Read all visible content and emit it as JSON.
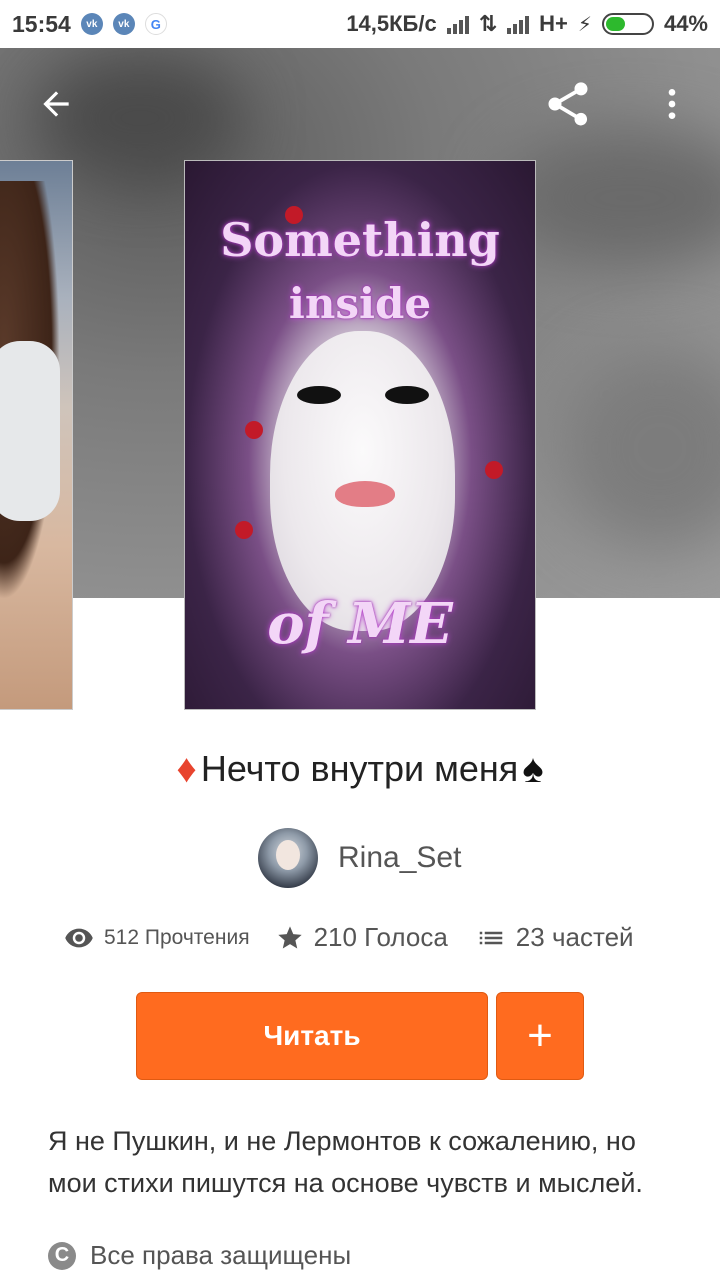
{
  "status_bar": {
    "time": "15:54",
    "apps": [
      "vk",
      "vk",
      "G"
    ],
    "speed": "14,5КБ/с",
    "network": "H+",
    "battery": "44%"
  },
  "header": {
    "back_icon": "arrow-left-icon",
    "share_icon": "share-icon",
    "more_icon": "more-vertical-icon"
  },
  "cover": {
    "line1": "Something",
    "line2": "inside",
    "line3": "of ME"
  },
  "story": {
    "title_prefix": "♦",
    "title": "Нечто внутри меня",
    "title_suffix": "♠",
    "author": "Rina_Set",
    "reads": "512 Прочтения",
    "votes": "210 Голоса",
    "parts": "23 частей",
    "read_label": "Читать",
    "add_label": "+",
    "description": "Я не Пушкин, и не Лермонтов к сожалению, но мои стихи пишутся на основе чувств и мыслей.",
    "rights": "Все права защищены"
  },
  "colors": {
    "accent": "#ff6b1f",
    "diamond": "#e8442e"
  }
}
